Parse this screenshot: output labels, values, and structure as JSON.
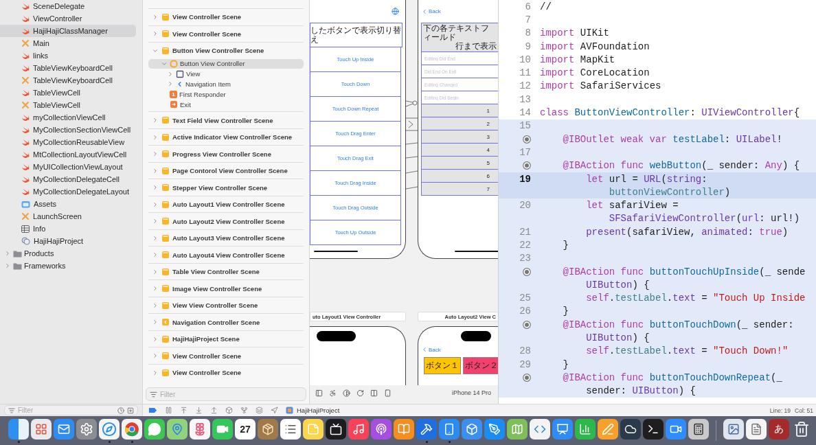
{
  "navigator": {
    "files": [
      {
        "label": "SceneDelegate",
        "kind": "swift",
        "selected": false
      },
      {
        "label": "ViewController",
        "kind": "swift",
        "selected": false
      },
      {
        "label": "HajiHajiClassManager",
        "kind": "swift",
        "selected": true
      },
      {
        "label": "Main",
        "kind": "storyboard",
        "selected": false
      },
      {
        "label": "links",
        "kind": "swift",
        "selected": false
      },
      {
        "label": "TableViewKeyboardCell",
        "kind": "swift",
        "selected": false
      },
      {
        "label": "TableViewKeyboardCell",
        "kind": "storyboard",
        "selected": false
      },
      {
        "label": "TableViewCell",
        "kind": "swift",
        "selected": false
      },
      {
        "label": "TableViewCell",
        "kind": "storyboard",
        "selected": false
      },
      {
        "label": "myCollectionViewCell",
        "kind": "swift",
        "selected": false
      },
      {
        "label": "MyCollectionSectionViewCell",
        "kind": "swift",
        "selected": false
      },
      {
        "label": "MyCollectionReusableView",
        "kind": "swift",
        "selected": false
      },
      {
        "label": "MtCollectionLayoutViewCell",
        "kind": "swift",
        "selected": false
      },
      {
        "label": "MyUICollectionViewLayout",
        "kind": "swift",
        "selected": false
      },
      {
        "label": "MyCollectionDelegateCell",
        "kind": "swift",
        "selected": false
      },
      {
        "label": "MyCollectionDelegateLayout",
        "kind": "swift",
        "selected": false
      },
      {
        "label": "Assets",
        "kind": "assets",
        "selected": false
      },
      {
        "label": "LaunchScreen",
        "kind": "storyboard",
        "selected": false
      },
      {
        "label": "Info",
        "kind": "plist",
        "selected": false
      },
      {
        "label": "HajiHajiProject",
        "kind": "project",
        "selected": false
      }
    ],
    "groups": [
      {
        "label": "Products",
        "expanded": false
      },
      {
        "label": "Frameworks",
        "expanded": false
      }
    ],
    "filter": {
      "placeholder": "Filter"
    }
  },
  "outline": {
    "scenes": [
      {
        "label": "View Controller Scene",
        "kind": "scene",
        "expanded": false
      },
      {
        "label": "View Controller Scene",
        "kind": "scene",
        "expanded": false
      },
      {
        "label": "Button View Controller Scene",
        "kind": "scene",
        "expanded": true,
        "children": [
          {
            "label": "Button View Controller",
            "kind": "controller",
            "selected": true,
            "expanded": true,
            "children": [
              {
                "label": "View",
                "kind": "view",
                "selected": false,
                "expanded": false
              },
              {
                "label": "Navigation Item",
                "kind": "navitem",
                "selected": false,
                "expanded": false
              }
            ]
          },
          {
            "label": "First Responder",
            "kind": "responder",
            "badge": "1",
            "selected": false
          },
          {
            "label": "Exit",
            "kind": "exit",
            "selected": false
          }
        ]
      },
      {
        "label": "Text Field View Controller Scene",
        "kind": "scene",
        "expanded": false
      },
      {
        "label": "Active Indicator View Controller Scene",
        "kind": "scene",
        "expanded": false
      },
      {
        "label": "Progress View Controller Scene",
        "kind": "scene",
        "expanded": false
      },
      {
        "label": "Page Contorol View Controller Scene",
        "kind": "scene",
        "expanded": false
      },
      {
        "label": "Stepper View Controller Scene",
        "kind": "scene",
        "expanded": false
      },
      {
        "label": "Auto Layout1 View Controller Scene",
        "kind": "scene",
        "expanded": false
      },
      {
        "label": "Auto Layout2 View Controller Scene",
        "kind": "scene",
        "expanded": false
      },
      {
        "label": "Auto Layout3 View Controller Scene",
        "kind": "scene",
        "expanded": false
      },
      {
        "label": "Auto Layout4 View Controller Scene",
        "kind": "scene",
        "expanded": false
      },
      {
        "label": "Table View Controller Scene",
        "kind": "scene",
        "expanded": false
      },
      {
        "label": "Image View Controller Scene",
        "kind": "scene",
        "expanded": false
      },
      {
        "label": "View View Controller Scene",
        "kind": "scene",
        "expanded": false
      },
      {
        "label": "Navigation Controller Scene",
        "kind": "navigation",
        "expanded": false
      },
      {
        "label": "HajiHajiProject Scene",
        "kind": "scene",
        "expanded": false
      },
      {
        "label": "View Controller Scene",
        "kind": "scene",
        "expanded": false
      },
      {
        "label": "View Controller Scene",
        "kind": "scene",
        "expanded": false
      }
    ],
    "filter": {
      "placeholder": "Filter"
    }
  },
  "canvas": {
    "button_scene": {
      "title": "したボタンで表示切り替え",
      "buttons": [
        "Touch Up Inside",
        "Touch Down",
        "Touch Down Repeat",
        "Touch Drag Enter",
        "Touch Drag Exit",
        "Touch Drag Inside",
        "Touch Drag Outside",
        "Touch Up Outside"
      ]
    },
    "text_field_scene": {
      "back": "Back",
      "label_lines": [
        "下の各テキストフィールド",
        "行まで表示"
      ],
      "fields": [
        {
          "placeholder": "Editing Did End"
        },
        {
          "placeholder": "Did End On Exit"
        },
        {
          "placeholder": "Editing Changed"
        },
        {
          "placeholder": "Editing Did Begin"
        }
      ],
      "rows": [
        "1",
        "2",
        "3",
        "4",
        "5",
        "6",
        "7"
      ]
    },
    "scene_titles": [
      "uto Layout1 View Controller",
      "Auto Layout2 View C"
    ],
    "auto_layout2_scene": {
      "back": "Back",
      "buttons": [
        {
          "label": "ボタン１",
          "color": "#ffc400"
        },
        {
          "label": "ボタン２",
          "color": "#f2416e"
        }
      ]
    },
    "device": "iPhone 14 Pro"
  },
  "editor": {
    "rows": [
      {
        "number": "6",
        "marker": false,
        "current": false,
        "highlighted": false,
        "kind": "top",
        "tokens": [
          {
            "text": "//",
            "kind": "plain"
          }
        ]
      },
      {
        "number": "7",
        "marker": false,
        "current": false,
        "highlighted": false
      },
      {
        "number": "8",
        "marker": false,
        "current": false,
        "highlighted": false,
        "kind": "top",
        "tokens": [
          {
            "text": "import",
            "kind": "keyword"
          },
          {
            "text": " UIKit",
            "kind": "plain"
          }
        ]
      },
      {
        "number": "9",
        "marker": false,
        "current": false,
        "highlighted": false,
        "kind": "top",
        "tokens": [
          {
            "text": "import",
            "kind": "keyword"
          },
          {
            "text": " AVFoundation",
            "kind": "plain"
          }
        ]
      },
      {
        "number": "10",
        "marker": false,
        "current": false,
        "highlighted": false,
        "kind": "top",
        "tokens": [
          {
            "text": "import",
            "kind": "keyword"
          },
          {
            "text": " MapKit",
            "kind": "plain"
          }
        ]
      },
      {
        "number": "11",
        "marker": false,
        "current": false,
        "highlighted": false,
        "kind": "top",
        "tokens": [
          {
            "text": "import",
            "kind": "keyword"
          },
          {
            "text": " CoreLocation",
            "kind": "plain"
          }
        ]
      },
      {
        "number": "12",
        "marker": false,
        "current": false,
        "highlighted": false,
        "kind": "top",
        "tokens": [
          {
            "text": "import",
            "kind": "keyword"
          },
          {
            "text": " SafariServices",
            "kind": "plain"
          }
        ]
      },
      {
        "number": "13",
        "marker": false,
        "current": false,
        "highlighted": false
      },
      {
        "number": "14",
        "marker": false,
        "current": false,
        "highlighted": false,
        "kind": "top",
        "tokens": [
          {
            "text": "class ",
            "kind": "keyword"
          },
          {
            "text": "ButtonViewController",
            "kind": "declaration"
          },
          {
            "text": ": ",
            "kind": "plain"
          },
          {
            "text": "UIViewController",
            "kind": "type"
          },
          {
            "text": "{",
            "kind": "plain"
          }
        ]
      },
      {
        "number": "15",
        "marker": false,
        "current": false,
        "highlighted": true
      },
      {
        "marker": true,
        "current": false,
        "highlighted": true,
        "kind": "member",
        "tokens": [
          {
            "text": "@IBOutlet weak var ",
            "kind": "keyword"
          },
          {
            "text": "testLabel",
            "kind": "declaration"
          },
          {
            "text": ": ",
            "kind": "plain"
          },
          {
            "text": "UILabel",
            "kind": "type"
          },
          {
            "text": "!",
            "kind": "plain"
          }
        ]
      },
      {
        "number": "17",
        "marker": false,
        "current": false,
        "highlighted": true
      },
      {
        "marker": true,
        "current": false,
        "highlighted": true,
        "kind": "member",
        "tokens": [
          {
            "text": "@IBAction func ",
            "kind": "keyword"
          },
          {
            "text": "webButton",
            "kind": "declaration"
          },
          {
            "text": "(_ sender: ",
            "kind": "plain"
          },
          {
            "text": "Any",
            "kind": "keyword"
          },
          {
            "text": ") {",
            "kind": "plain"
          }
        ]
      },
      {
        "number": "19",
        "marker": false,
        "current": true,
        "highlighted": true,
        "kind": "body",
        "tokens": [
          {
            "text": "let",
            "kind": "keyword"
          },
          {
            "text": " url = ",
            "kind": "plain"
          },
          {
            "text": "URL",
            "kind": "type"
          },
          {
            "text": "(",
            "kind": "plain"
          },
          {
            "text": "string",
            "kind": "type"
          },
          {
            "text": ":",
            "kind": "plain"
          }
        ]
      },
      {
        "marker": false,
        "current": true,
        "highlighted": true,
        "kind": "wrap",
        "tokens": [
          {
            "text": "buttonViewController",
            "kind": "project"
          },
          {
            "text": ")",
            "kind": "plain"
          }
        ]
      },
      {
        "number": "20",
        "marker": false,
        "current": false,
        "highlighted": true,
        "kind": "body",
        "tokens": [
          {
            "text": "let",
            "kind": "keyword"
          },
          {
            "text": " safariView =",
            "kind": "plain"
          }
        ]
      },
      {
        "marker": false,
        "current": false,
        "highlighted": true,
        "kind": "wrap",
        "tokens": [
          {
            "text": "SFSafariViewController",
            "kind": "type"
          },
          {
            "text": "(",
            "kind": "plain"
          },
          {
            "text": "url",
            "kind": "type"
          },
          {
            "text": ": url!)",
            "kind": "plain"
          }
        ]
      },
      {
        "number": "21",
        "marker": false,
        "current": false,
        "highlighted": true,
        "kind": "body",
        "tokens": [
          {
            "text": "present",
            "kind": "type"
          },
          {
            "text": "(safariView, ",
            "kind": "plain"
          },
          {
            "text": "animated",
            "kind": "type"
          },
          {
            "text": ": ",
            "kind": "plain"
          },
          {
            "text": "true",
            "kind": "keyword"
          },
          {
            "text": ")",
            "kind": "plain"
          }
        ]
      },
      {
        "number": "22",
        "marker": false,
        "current": false,
        "highlighted": true,
        "kind": "member",
        "tokens": [
          {
            "text": "}",
            "kind": "plain"
          }
        ]
      },
      {
        "number": "23",
        "marker": false,
        "current": false,
        "highlighted": true
      },
      {
        "marker": true,
        "current": false,
        "highlighted": true,
        "kind": "member",
        "tokens": [
          {
            "text": "@IBAction func ",
            "kind": "keyword"
          },
          {
            "text": "buttonTouchUpInside",
            "kind": "declaration"
          },
          {
            "text": "(_ sende",
            "kind": "plain"
          }
        ]
      },
      {
        "marker": false,
        "current": false,
        "highlighted": true,
        "kind": "body",
        "tokens": [
          {
            "text": "UIButton",
            "kind": "type"
          },
          {
            "text": ") {",
            "kind": "plain"
          }
        ]
      },
      {
        "number": "25",
        "marker": false,
        "current": false,
        "highlighted": true,
        "kind": "body",
        "tokens": [
          {
            "text": "self",
            "kind": "keyword"
          },
          {
            "text": ".",
            "kind": "plain"
          },
          {
            "text": "testLabel",
            "kind": "project"
          },
          {
            "text": ".",
            "kind": "plain"
          },
          {
            "text": "text",
            "kind": "type"
          },
          {
            "text": " = ",
            "kind": "plain"
          },
          {
            "text": "\"Touch Up Inside",
            "kind": "string"
          }
        ]
      },
      {
        "number": "26",
        "marker": false,
        "current": false,
        "highlighted": true,
        "kind": "member",
        "tokens": [
          {
            "text": "}",
            "kind": "plain"
          }
        ]
      },
      {
        "marker": true,
        "current": false,
        "highlighted": true,
        "kind": "member",
        "tokens": [
          {
            "text": "@IBAction func ",
            "kind": "keyword"
          },
          {
            "text": "buttonTouchDown",
            "kind": "declaration"
          },
          {
            "text": "(_ sender:",
            "kind": "plain"
          }
        ]
      },
      {
        "marker": false,
        "current": false,
        "highlighted": true,
        "kind": "body",
        "tokens": [
          {
            "text": "UIButton",
            "kind": "type"
          },
          {
            "text": ") {",
            "kind": "plain"
          }
        ]
      },
      {
        "number": "28",
        "marker": false,
        "current": false,
        "highlighted": true,
        "kind": "body",
        "tokens": [
          {
            "text": "self",
            "kind": "keyword"
          },
          {
            "text": ".",
            "kind": "plain"
          },
          {
            "text": "testLabel",
            "kind": "project"
          },
          {
            "text": ".",
            "kind": "plain"
          },
          {
            "text": "text",
            "kind": "type"
          },
          {
            "text": " = ",
            "kind": "plain"
          },
          {
            "text": "\"Touch Down!\"",
            "kind": "string"
          }
        ]
      },
      {
        "number": "29",
        "marker": false,
        "current": false,
        "highlighted": true,
        "kind": "member",
        "tokens": [
          {
            "text": "}",
            "kind": "plain"
          }
        ]
      },
      {
        "marker": true,
        "current": false,
        "highlighted": true,
        "kind": "member",
        "tokens": [
          {
            "text": "@IBAction func ",
            "kind": "keyword"
          },
          {
            "text": "buttonTouchDownRepeat",
            "kind": "declaration"
          },
          {
            "text": "(_",
            "kind": "plain"
          }
        ]
      },
      {
        "marker": false,
        "current": false,
        "highlighted": true,
        "kind": "body",
        "tokens": [
          {
            "text": "sender: ",
            "kind": "plain"
          },
          {
            "text": "UIButton",
            "kind": "type"
          },
          {
            "text": ") {",
            "kind": "plain"
          }
        ]
      }
    ]
  },
  "debug_bar": {
    "breakpoints_active": true,
    "target": "HajiHajiProject"
  },
  "status": {
    "line": "Line: 19",
    "column": "Col: 51"
  },
  "dock": {
    "apps": [
      {
        "kind": "finder",
        "running": true
      },
      {
        "kind": "launchpad",
        "running": false
      },
      {
        "kind": "mail",
        "running": false
      },
      {
        "kind": "settings",
        "running": false
      },
      {
        "kind": "safari",
        "running": true
      },
      {
        "kind": "chrome",
        "running": true
      },
      {
        "kind": "messages",
        "running": false
      },
      {
        "kind": "maps",
        "running": false
      },
      {
        "kind": "photos",
        "running": false
      },
      {
        "kind": "facetime",
        "running": false
      },
      {
        "kind": "calendar",
        "running": false,
        "label": "27"
      },
      {
        "kind": "package",
        "running": false
      },
      {
        "kind": "reminders",
        "running": false
      },
      {
        "kind": "notes",
        "running": false
      },
      {
        "kind": "tv",
        "running": false
      },
      {
        "kind": "music",
        "running": false
      },
      {
        "kind": "podcasts",
        "running": false
      },
      {
        "kind": "books",
        "running": false
      },
      {
        "kind": "xcode",
        "running": true
      },
      {
        "kind": "simulator",
        "running": true
      },
      {
        "kind": "cube",
        "running": false
      },
      {
        "kind": "appstore",
        "running": false
      },
      {
        "kind": "map",
        "running": false
      },
      {
        "kind": "vscode",
        "running": false
      },
      {
        "kind": "keynote",
        "running": false
      },
      {
        "kind": "numbers",
        "running": false
      },
      {
        "kind": "pages",
        "running": false
      },
      {
        "kind": "cloud",
        "running": false
      },
      {
        "kind": "terminal",
        "running": false
      },
      {
        "kind": "zoom",
        "running": false
      },
      {
        "kind": "calculator",
        "running": false
      }
    ],
    "extras": [
      {
        "kind": "preview",
        "running": false
      },
      {
        "kind": "textedit",
        "running": false
      },
      {
        "kind": "dictionary",
        "running": false,
        "label": "あ"
      },
      {
        "kind": "trash",
        "running": false
      }
    ]
  }
}
